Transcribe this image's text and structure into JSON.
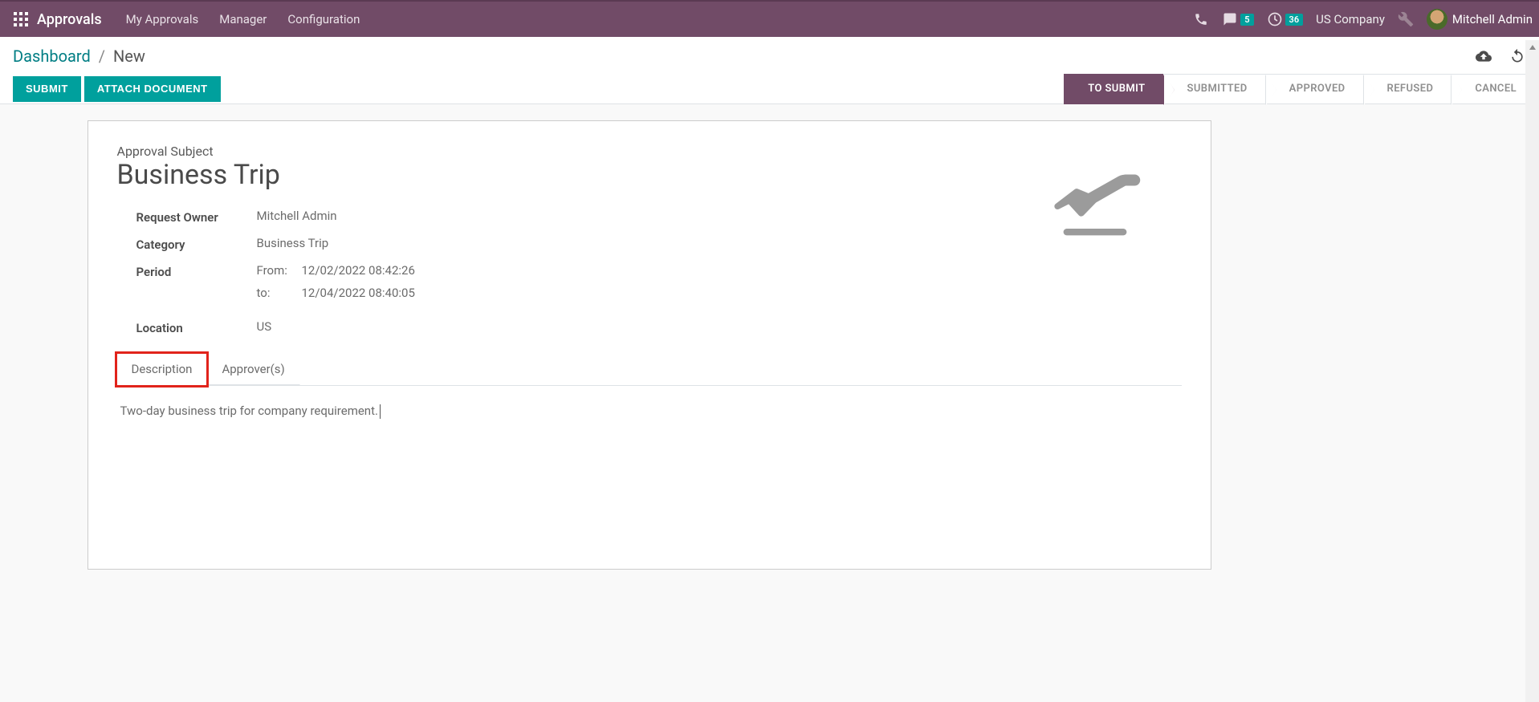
{
  "navbar": {
    "app_title": "Approvals",
    "links": [
      "My Approvals",
      "Manager",
      "Configuration"
    ],
    "messages_badge": "5",
    "activities_badge": "36",
    "company": "US Company",
    "user_name": "Mitchell Admin"
  },
  "breadcrumb": {
    "root": "Dashboard",
    "current": "New"
  },
  "actions": {
    "submit": "Submit",
    "attach": "Attach Document"
  },
  "status_steps": [
    "TO SUBMIT",
    "SUBMITTED",
    "APPROVED",
    "REFUSED",
    "CANCEL"
  ],
  "form": {
    "subject_label": "Approval Subject",
    "subject_value": "Business Trip",
    "fields": {
      "request_owner": {
        "label": "Request Owner",
        "value": "Mitchell Admin"
      },
      "category": {
        "label": "Category",
        "value": "Business Trip"
      },
      "period": {
        "label": "Period",
        "from_label": "From:",
        "from_value": "12/02/2022 08:42:26",
        "to_label": "to:",
        "to_value": "12/04/2022 08:40:05"
      },
      "location": {
        "label": "Location",
        "value": "US"
      }
    },
    "tabs": {
      "description": "Description",
      "approvers": "Approver(s)"
    },
    "description_text": "Two-day business trip for company requirement."
  }
}
